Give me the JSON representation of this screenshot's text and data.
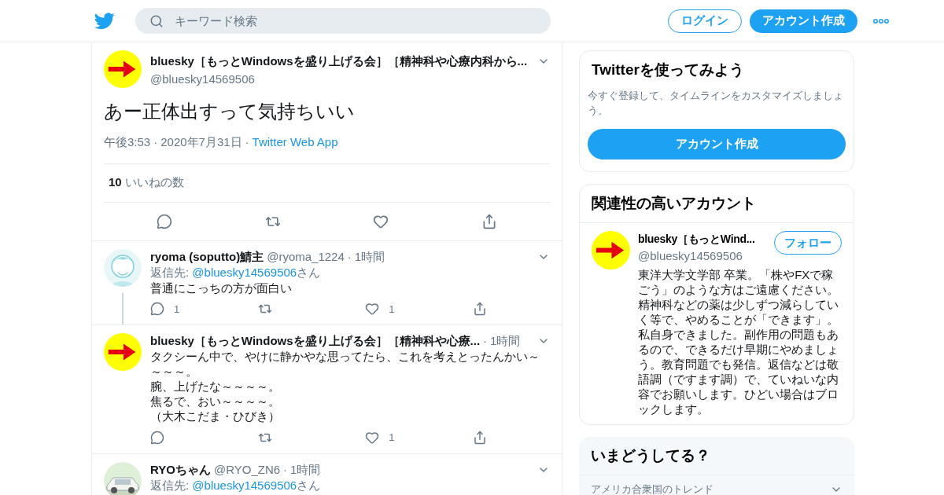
{
  "header": {
    "search": {
      "placeholder": "キーワード検索"
    },
    "login": "ログイン",
    "signup": "アカウント作成"
  },
  "main_tweet": {
    "name": "bluesky［もっとWindowsを盛り上げる会］［精神科や心療内科から...",
    "handle": "@bluesky14569506",
    "text": "あー正体出すって気持ちいい",
    "time": "午後3:53",
    "date": "2020年7月31日",
    "source": "Twitter Web App",
    "separator": "·",
    "likes_count": "10",
    "likes_label": "いいねの数"
  },
  "replies": [
    {
      "kind": "picture",
      "name": "ryoma (soputto)鯖主",
      "handle": "@ryoma_1224",
      "separator": "·",
      "time": "1時間",
      "reply_prefix": "返信先: ",
      "reply_to": "@bluesky14569506",
      "reply_suffix": "さん",
      "lines": [
        "普通にこっちの方が面白い"
      ],
      "reply_count": "1",
      "like_count": "1",
      "thread": true
    },
    {
      "kind": "arrow",
      "name": "bluesky［もっとWindowsを盛り上げる会］［精神科や心療...",
      "separator": "·",
      "time": "1時間",
      "lines": [
        "タクシーん中で、やけに静かやな思ってたら、これを考えとったんかい～～～～。",
        "腕、上げたな～～～～。",
        "焦るで、おい～～～～。",
        "（大木こだま・ひびき）"
      ],
      "like_count": "1",
      "thread": false
    },
    {
      "kind": "picture",
      "name": "RYOちゃん",
      "handle": "@RYO_ZN6",
      "separator": "·",
      "time": "1時間",
      "reply_prefix": "返信先: ",
      "reply_to": "@bluesky14569506",
      "reply_suffix": "さん",
      "thread": false
    }
  ],
  "signup_card": {
    "title": "Twitterを使ってみよう",
    "text": "今すぐ登録して、タイムラインをカスタマイズしましょう。",
    "button": "アカウント作成"
  },
  "related": {
    "title": "関連性の高いアカウント",
    "name": "bluesky［もっとWind...",
    "handle": "@bluesky14569506",
    "follow": "フォロー",
    "bio": "東洋大学文学部 卒業。「株やFXで稼ごう」のような方はご遠慮ください。精神科などの薬は少しずつ減らしていく等で、やめることが「できます」。私自身できました。副作用の問題もあるので、できるだけ早期にやめましょう。教育問題でも発信。返信などは敬語調（ですます調）で、ていねいな内容でお願いします。ひどい場合はブロックします。"
  },
  "trends": {
    "title": "いまどうしてる？",
    "location": "アメリカ合衆国のトレンド"
  }
}
